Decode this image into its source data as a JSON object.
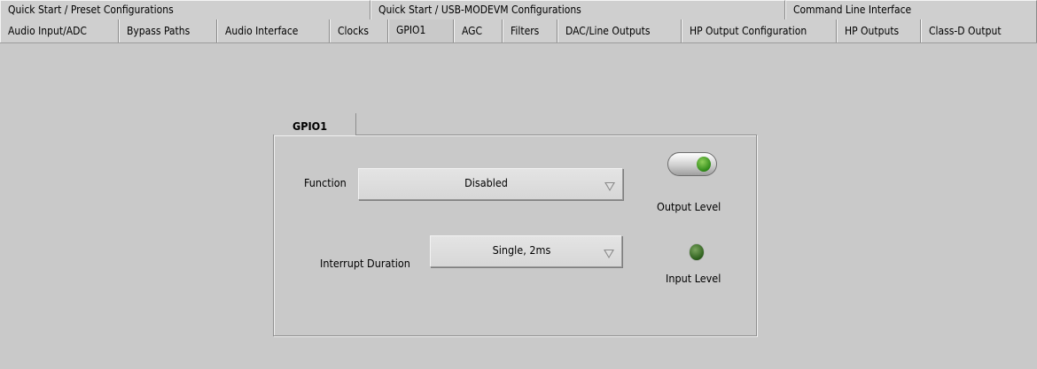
{
  "top_tabs": [
    {
      "label": "Quick Start / Preset Configurations"
    },
    {
      "label": "Quick Start / USB-MODEVM Configurations"
    },
    {
      "label": "Command Line Interface"
    }
  ],
  "tabs": [
    {
      "label": "Audio Input/ADC"
    },
    {
      "label": "Bypass Paths"
    },
    {
      "label": "Audio Interface"
    },
    {
      "label": "Clocks"
    },
    {
      "label": "GPIO1",
      "active": true
    },
    {
      "label": "AGC"
    },
    {
      "label": "Filters"
    },
    {
      "label": "DAC/Line Outputs"
    },
    {
      "label": "HP Output Configuration"
    },
    {
      "label": "HP Outputs"
    },
    {
      "label": "Class-D Output"
    }
  ],
  "gpio1": {
    "group_title": "GPIO1",
    "function_label": "Function",
    "function_value": "Disabled",
    "interrupt_label": "Interrupt Duration",
    "interrupt_value": "Single, 2ms",
    "output_level_label": "Output Level",
    "input_level_label": "Input Level"
  },
  "colors": {
    "background": "#c9c9c9",
    "led_on": "#2f8a18",
    "led_dim": "#2c5f1c"
  }
}
